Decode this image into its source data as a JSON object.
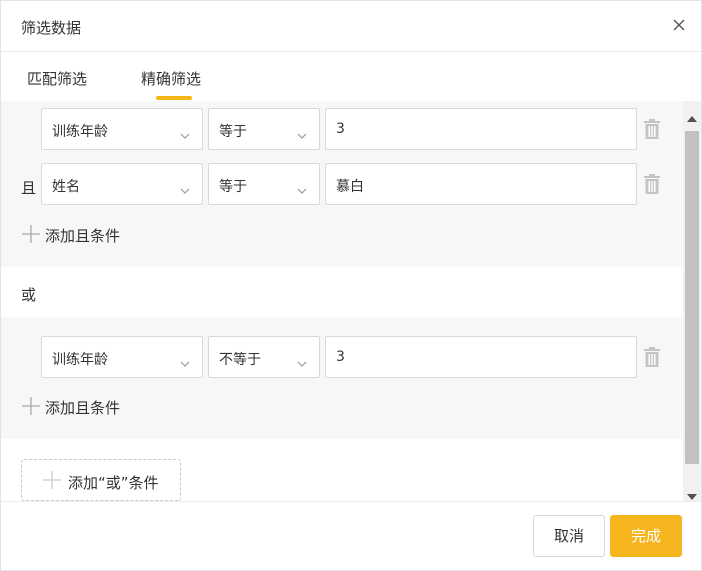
{
  "dialog": {
    "title": "筛选数据"
  },
  "tabs": [
    {
      "label": "匹配筛选",
      "active": false
    },
    {
      "label": "精确筛选",
      "active": true
    }
  ],
  "accent_color": "#f5b716",
  "groups": [
    {
      "conditions": [
        {
          "connector": "",
          "field": "训练年龄",
          "operator": "等于",
          "value": "3"
        },
        {
          "connector": "且",
          "field": "姓名",
          "operator": "等于",
          "value": "慕白"
        }
      ],
      "add_and_label": "添加且条件"
    },
    {
      "conditions": [
        {
          "connector": "",
          "field": "训练年龄",
          "operator": "不等于",
          "value": "3"
        }
      ],
      "add_and_label": "添加且条件"
    }
  ],
  "or_label": "或",
  "add_or_label": "添加“或”条件",
  "footer": {
    "cancel_label": "取消",
    "done_label": "完成"
  },
  "icons": [
    "close-icon",
    "chevron-down-icon",
    "trash-icon",
    "plus-icon",
    "scroll-up-arrow-icon",
    "scroll-down-arrow-icon"
  ]
}
